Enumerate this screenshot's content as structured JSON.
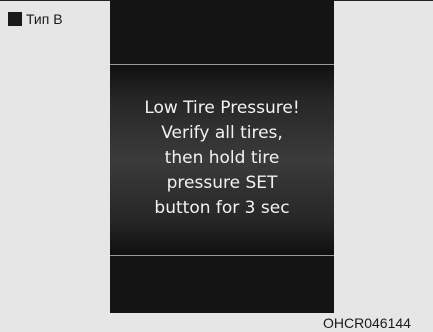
{
  "figure": {
    "type_label": "Тип B",
    "code": "OHCR046144"
  },
  "display": {
    "message_lines": [
      "Low Tire Pressure!",
      "Verify all tires,",
      "then hold tire",
      "pressure SET",
      "button for 3 sec"
    ]
  }
}
